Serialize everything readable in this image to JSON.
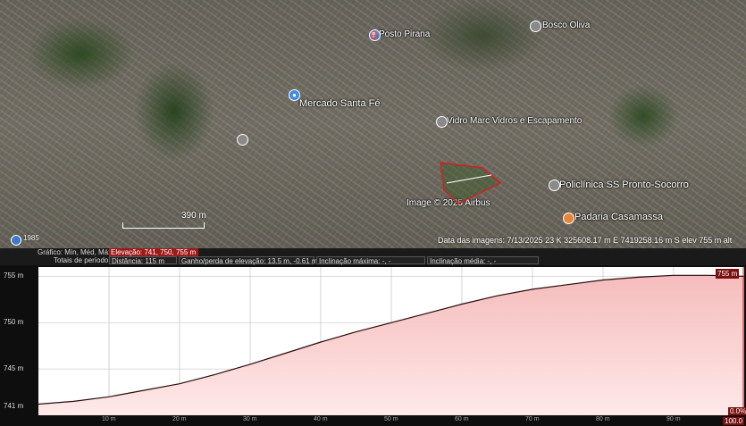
{
  "map": {
    "labels": [
      {
        "name": "label-posto-pirana",
        "text": "Posto Pirana"
      },
      {
        "name": "label-bosco-oliva",
        "text": "Bosco Oliva"
      },
      {
        "name": "label-mercado-santa-fe",
        "text": "Mercado Santa Fé"
      },
      {
        "name": "label-vidros",
        "text": "Vidro Marc Vidros e Escapamento"
      },
      {
        "name": "label-policlinica",
        "text": "Policlínica SS Pronto-Socorro"
      },
      {
        "name": "label-padaria",
        "text": "Padaria Casamassa"
      },
      {
        "name": "label-image-credit",
        "text": "Image © 2025 Airbus"
      }
    ],
    "scale_label": "390 m",
    "year_label": "1985",
    "status": "Data das imagens: 7/13/2025   23 K 325608.17 m E 7419258.16 m S   elev  755 m   alt"
  },
  "profile": {
    "header_graph_label": "Gráfico: Mín, Méd, Máx",
    "header_elevation": "Elevação: 741, 750, 755 m",
    "totals_label": "Totais de período:",
    "distance": "Distância: 115 m",
    "gain_loss": "Ganho/perda de elevação: 13.5 m, -0.61 m",
    "max_slope": "Inclinação máxima: -, -",
    "avg_slope": "Inclinação média: -, -",
    "badge_max": "755 m",
    "badge_pct": "0.0%",
    "badge_end": "100.0"
  },
  "chart_data": {
    "type": "area",
    "y_ticks": [
      "755 m",
      "750 m",
      "745 m",
      "741 m"
    ],
    "y_tick_values": [
      755,
      750,
      745,
      741
    ],
    "x_ticks": [
      "10 m",
      "20 m",
      "30 m",
      "40 m",
      "50 m",
      "60 m",
      "70 m",
      "80 m",
      "90 m"
    ],
    "x_tick_values": [
      10,
      20,
      30,
      40,
      50,
      60,
      70,
      80,
      90
    ],
    "xlim": [
      0,
      100
    ],
    "ylim": [
      740,
      756
    ],
    "x": [
      0,
      5,
      10,
      15,
      20,
      25,
      30,
      35,
      40,
      45,
      50,
      55,
      60,
      65,
      70,
      75,
      80,
      85,
      90,
      95,
      100
    ],
    "y": [
      741.2,
      741.5,
      742.0,
      742.7,
      743.4,
      744.4,
      745.5,
      746.7,
      747.9,
      749.0,
      750.0,
      751.0,
      752.0,
      752.9,
      753.6,
      754.1,
      754.6,
      754.9,
      755.1,
      755.1,
      755.0
    ],
    "colors": {
      "fill_top": "#f5bcbc",
      "fill_bottom": "#ffe9e9",
      "line": "#2a0a0a",
      "grid": "#bbbbbb"
    }
  }
}
